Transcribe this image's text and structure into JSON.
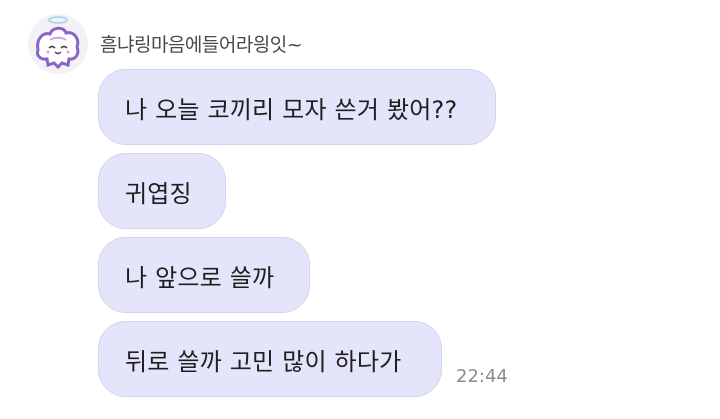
{
  "sender": {
    "name": "흠냐링마음에들어라읭잇~"
  },
  "messages": [
    {
      "text": "나 오늘 코끼리 모자 쓴거 봤어??"
    },
    {
      "text": "귀엽징"
    },
    {
      "text": "나 앞으로 쓸까"
    },
    {
      "text": "뒤로 쓸까 고민 많이 하다가"
    }
  ],
  "timestamp": "22:44",
  "colors": {
    "bubble": "#e4e4fb",
    "bubble_border": "#d3d3ef",
    "name": "#4a4a4a",
    "timestamp": "#8c8c8c"
  },
  "icons": {
    "avatar": "angel-cloud-avatar-icon"
  }
}
